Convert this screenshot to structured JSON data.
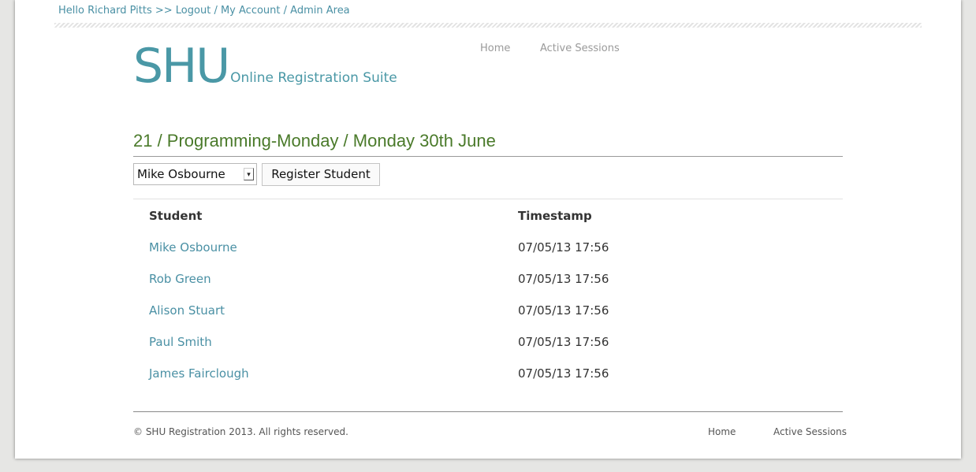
{
  "topbar": {
    "greeting": "Hello Richard Pitts >>",
    "logout": "Logout",
    "sep1": "/",
    "my_account": "My Account",
    "sep2": "/",
    "admin_area": "Admin Area"
  },
  "logo": {
    "main": "SHU",
    "sub": "Online Registration Suite"
  },
  "nav": {
    "home": "Home",
    "active_sessions": "Active Sessions"
  },
  "page_title": "21 / Programming-Monday / Monday 30th June",
  "register": {
    "selected_student": "Mike Osbourne",
    "button_label": "Register Student"
  },
  "table": {
    "headers": {
      "student": "Student",
      "timestamp": "Timestamp"
    },
    "rows": [
      {
        "student": "Mike Osbourne",
        "timestamp": "07/05/13 17:56"
      },
      {
        "student": "Rob Green",
        "timestamp": "07/05/13 17:56"
      },
      {
        "student": "Alison Stuart",
        "timestamp": "07/05/13 17:56"
      },
      {
        "student": "Paul Smith",
        "timestamp": "07/05/13 17:56"
      },
      {
        "student": "James Fairclough",
        "timestamp": "07/05/13 17:56"
      }
    ]
  },
  "footer": {
    "copyright": "© SHU Registration 2013. All rights reserved.",
    "home": "Home",
    "active_sessions": "Active Sessions"
  },
  "colors": {
    "accent": "#4a90a4",
    "heading": "#4a7a2a",
    "background": "#e6e6e4"
  }
}
